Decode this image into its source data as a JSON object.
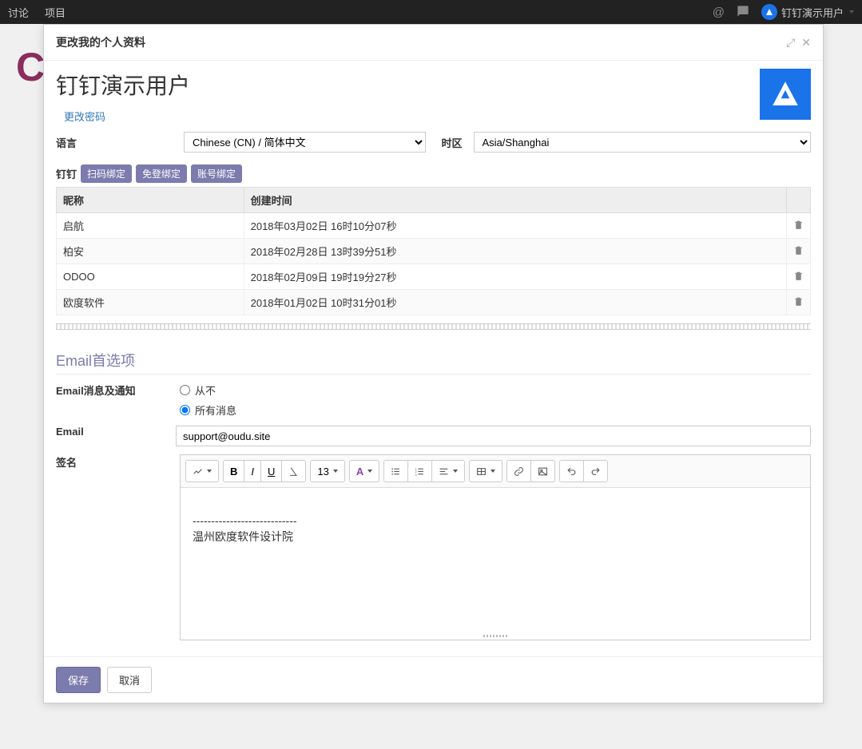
{
  "nav": {
    "discuss": "讨论",
    "project": "项目",
    "username": "钉钉演示用户"
  },
  "modal": {
    "title": "更改我的个人资料",
    "user_name": "钉钉演示用户",
    "change_password": "更改密码",
    "lang_label": "语言",
    "lang_value": "Chinese (CN) / 简体中文",
    "tz_label": "时区",
    "tz_value": "Asia/Shanghai",
    "ding_label": "钉钉",
    "ding_buttons": [
      "扫码绑定",
      "免登绑定",
      "账号绑定"
    ],
    "table": {
      "headers": [
        "昵称",
        "创建时间"
      ],
      "rows": [
        {
          "nick": "启航",
          "time": "2018年03月02日 16时10分07秒"
        },
        {
          "nick": "柏安",
          "time": "2018年02月28日 13时39分51秒"
        },
        {
          "nick": "ODOO",
          "time": "2018年02月09日 19时19分27秒"
        },
        {
          "nick": "欧度软件",
          "time": "2018年01月02日 10时31分01秒"
        }
      ]
    },
    "email_section": "Email首选项",
    "email_notify_label": "Email消息及通知",
    "radio_never": "从不",
    "radio_all": "所有消息",
    "email_label": "Email",
    "email_value": "support@oudu.site",
    "signature_label": "签名",
    "font_size": "13",
    "signature_line1": "----------------------------",
    "signature_line2": "温州欧度软件设计院",
    "save": "保存",
    "cancel": "取消"
  }
}
